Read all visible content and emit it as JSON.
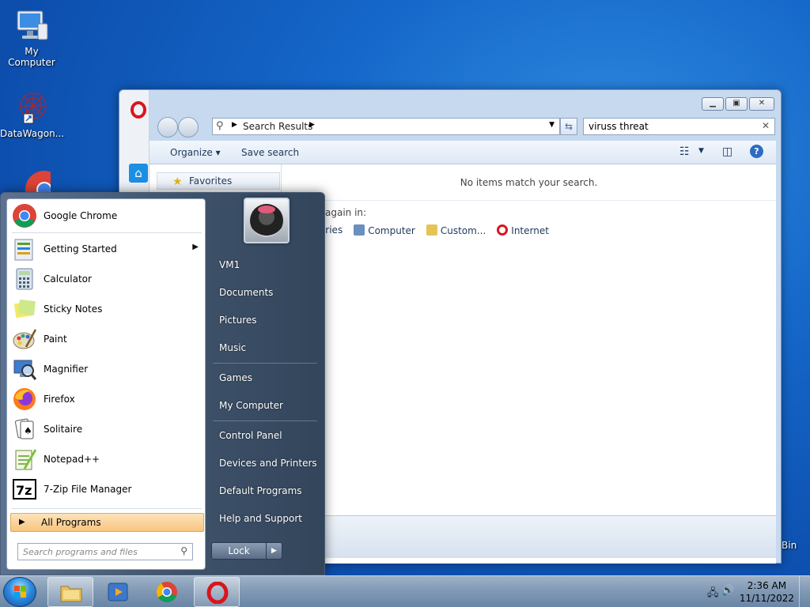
{
  "desktop": {
    "icons": [
      {
        "label": "My Computer"
      },
      {
        "label": "DataWagon..."
      },
      {
        "label": "Bin"
      }
    ]
  },
  "explorer": {
    "address": "Search Results",
    "search_query": "viruss threat",
    "toolbar": {
      "organize": "Organize ▾",
      "save_search": "Save search"
    },
    "favorites": "Favorites",
    "no_items": "No items match your search.",
    "search_again": "again in:",
    "search_again_items": [
      "raries",
      "Computer",
      "Custom...",
      "Internet"
    ]
  },
  "start_menu": {
    "programs": [
      {
        "label": "Google Chrome",
        "icon": "chrome-icon"
      },
      {
        "label": "Getting Started",
        "icon": "getting-started-icon",
        "submenu": true
      },
      {
        "label": "Calculator",
        "icon": "calculator-icon"
      },
      {
        "label": "Sticky Notes",
        "icon": "sticky-notes-icon"
      },
      {
        "label": "Paint",
        "icon": "paint-icon"
      },
      {
        "label": "Magnifier",
        "icon": "magnifier-icon"
      },
      {
        "label": "Firefox",
        "icon": "firefox-icon"
      },
      {
        "label": "Solitaire",
        "icon": "solitaire-icon"
      },
      {
        "label": "Notepad++",
        "icon": "notepadpp-icon"
      },
      {
        "label": "7-Zip File Manager",
        "icon": "7zip-icon"
      }
    ],
    "all_programs": "All Programs",
    "search_placeholder": "Search programs and files",
    "right_items": [
      "VM1",
      "Documents",
      "Pictures",
      "Music",
      "Games",
      "My Computer",
      "Control Panel",
      "Devices and Printers",
      "Default Programs",
      "Help and Support"
    ],
    "lock": "Lock"
  },
  "taskbar": {
    "time": "2:36 AM",
    "date": "11/11/2022"
  },
  "colors": {
    "accent_opera": "#d8161d",
    "all_programs_highlight": "#f8c57f"
  }
}
